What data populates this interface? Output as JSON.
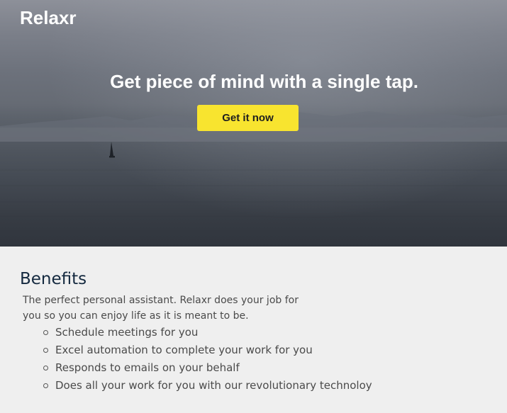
{
  "header": {
    "logo": "Relaxr"
  },
  "hero": {
    "headline": "Get piece of mind with a single tap.",
    "cta_label": "Get it now",
    "cta_color": "#f8e42f"
  },
  "benefits": {
    "title": "Benefits",
    "intro": "The perfect personal assistant. Relaxr does your job for you so you can enjoy life as it is meant to be.",
    "items": [
      "Schedule meetings for you",
      "Excel automation to complete your work for you",
      "Responds to emails on your behalf",
      "Does all your work for you with our revolutionary technoloy"
    ]
  }
}
